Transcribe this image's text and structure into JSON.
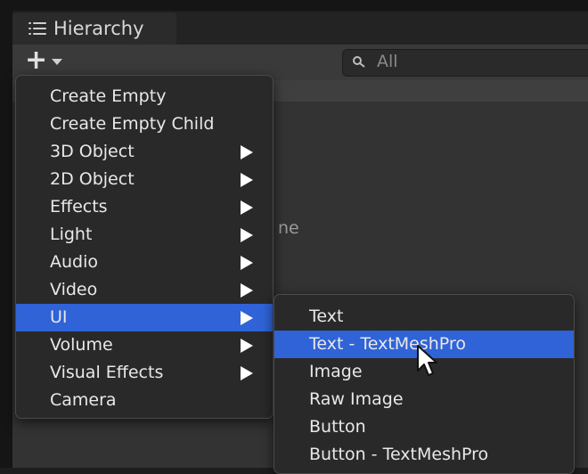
{
  "window": {
    "tab_title": "Hierarchy",
    "search": {
      "placeholder": "All"
    },
    "background_text": "ne"
  },
  "menu": {
    "items": [
      {
        "label": "Create Empty",
        "submenu": false
      },
      {
        "label": "Create Empty Child",
        "submenu": false
      },
      {
        "label": "3D Object",
        "submenu": true
      },
      {
        "label": "2D Object",
        "submenu": true
      },
      {
        "label": "Effects",
        "submenu": true
      },
      {
        "label": "Light",
        "submenu": true
      },
      {
        "label": "Audio",
        "submenu": true
      },
      {
        "label": "Video",
        "submenu": true
      },
      {
        "label": "UI",
        "submenu": true,
        "selected": true
      },
      {
        "label": "Volume",
        "submenu": true
      },
      {
        "label": "Visual Effects",
        "submenu": true
      },
      {
        "label": "Camera",
        "submenu": false
      }
    ]
  },
  "submenu": {
    "items": [
      {
        "label": "Text"
      },
      {
        "label": "Text - TextMeshPro",
        "highlighted": true
      },
      {
        "label": "Image"
      },
      {
        "label": "Raw Image"
      },
      {
        "label": "Button"
      },
      {
        "label": "Button - TextMeshPro"
      }
    ]
  },
  "icons": {
    "tab": "list-icon",
    "add": "plus-icon",
    "dropdown": "caret-down-icon",
    "search": "search-icon",
    "submenu_arrow": "triangle-right-icon",
    "pointer": "mouse-cursor-icon"
  },
  "colors": {
    "selection": "#2f63d7",
    "menu_bg": "#292929",
    "panel_bg": "#333333"
  }
}
